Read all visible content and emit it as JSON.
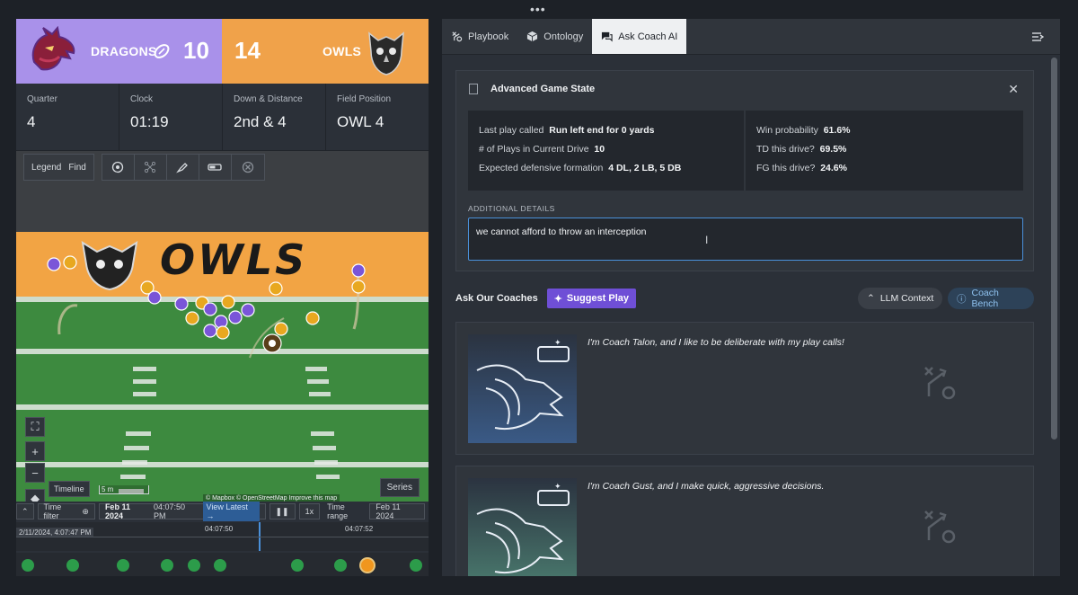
{
  "window": {
    "menu_dots": "•••"
  },
  "scoreboard": {
    "home": {
      "name": "DRAGONS",
      "score": "10"
    },
    "away": {
      "name": "OWLS",
      "score": "14"
    }
  },
  "stats": [
    {
      "label": "Quarter",
      "value": "4"
    },
    {
      "label": "Clock",
      "value": "01:19"
    },
    {
      "label": "Down & Distance",
      "value": "2nd & 4"
    },
    {
      "label": "Field Position",
      "value": "OWL 4"
    }
  ],
  "map_toolbar": {
    "legend": "Legend",
    "find": "Find"
  },
  "field": {
    "endzone_text": "OWLS"
  },
  "map_controls": {
    "timeline": "Timeline",
    "scale": "5 m",
    "series": "Series",
    "attribution": "© Mapbox © OpenStreetMap Improve this map"
  },
  "timeline": {
    "time_filter": "Time filter",
    "date": "Feb 11 2024",
    "time": "04:07:50 PM",
    "view_latest": "View Latest →",
    "speed": "1x",
    "time_range": "Time range",
    "range_date": "Feb 11 2024",
    "cursor_label": "2/11/2024, 4:07:47 PM",
    "tick1": "04:07:50",
    "tick2": "04:07:52"
  },
  "tabs": [
    {
      "label": "Playbook"
    },
    {
      "label": "Ontology"
    },
    {
      "label": "Ask Coach AI"
    }
  ],
  "game_state": {
    "title": "Advanced Game State",
    "last_play_label": "Last play called",
    "last_play_value": "Run left end for 0 yards",
    "plays_label": "# of Plays in Current Drive",
    "plays_value": "10",
    "formation_label": "Expected defensive formation",
    "formation_value": "4 DL, 2 LB, 5 DB",
    "win_label": "Win probability",
    "win_value": "61.6%",
    "td_label": "TD this drive?",
    "td_value": "69.5%",
    "fg_label": "FG this drive?",
    "fg_value": "24.6%",
    "additional_label": "ADDITIONAL DETAILS",
    "additional_value": "we cannot afford to throw an interception"
  },
  "coaches": {
    "title": "Ask Our Coaches",
    "suggest": "Suggest Play",
    "llm_context": "LLM Context",
    "coach_bench": "Coach Bench",
    "list": [
      {
        "quote": "I'm Coach Talon, and I like to be deliberate with my play calls!"
      },
      {
        "quote": "I'm Coach Gust, and I make quick, aggressive decisions."
      }
    ]
  },
  "colors": {
    "dragons": "#a991ea",
    "owls": "#f0a24a",
    "accent_purple": "#6f4fd6",
    "accent_blue": "#4a90d9",
    "field_green": "#3d8a3f"
  }
}
